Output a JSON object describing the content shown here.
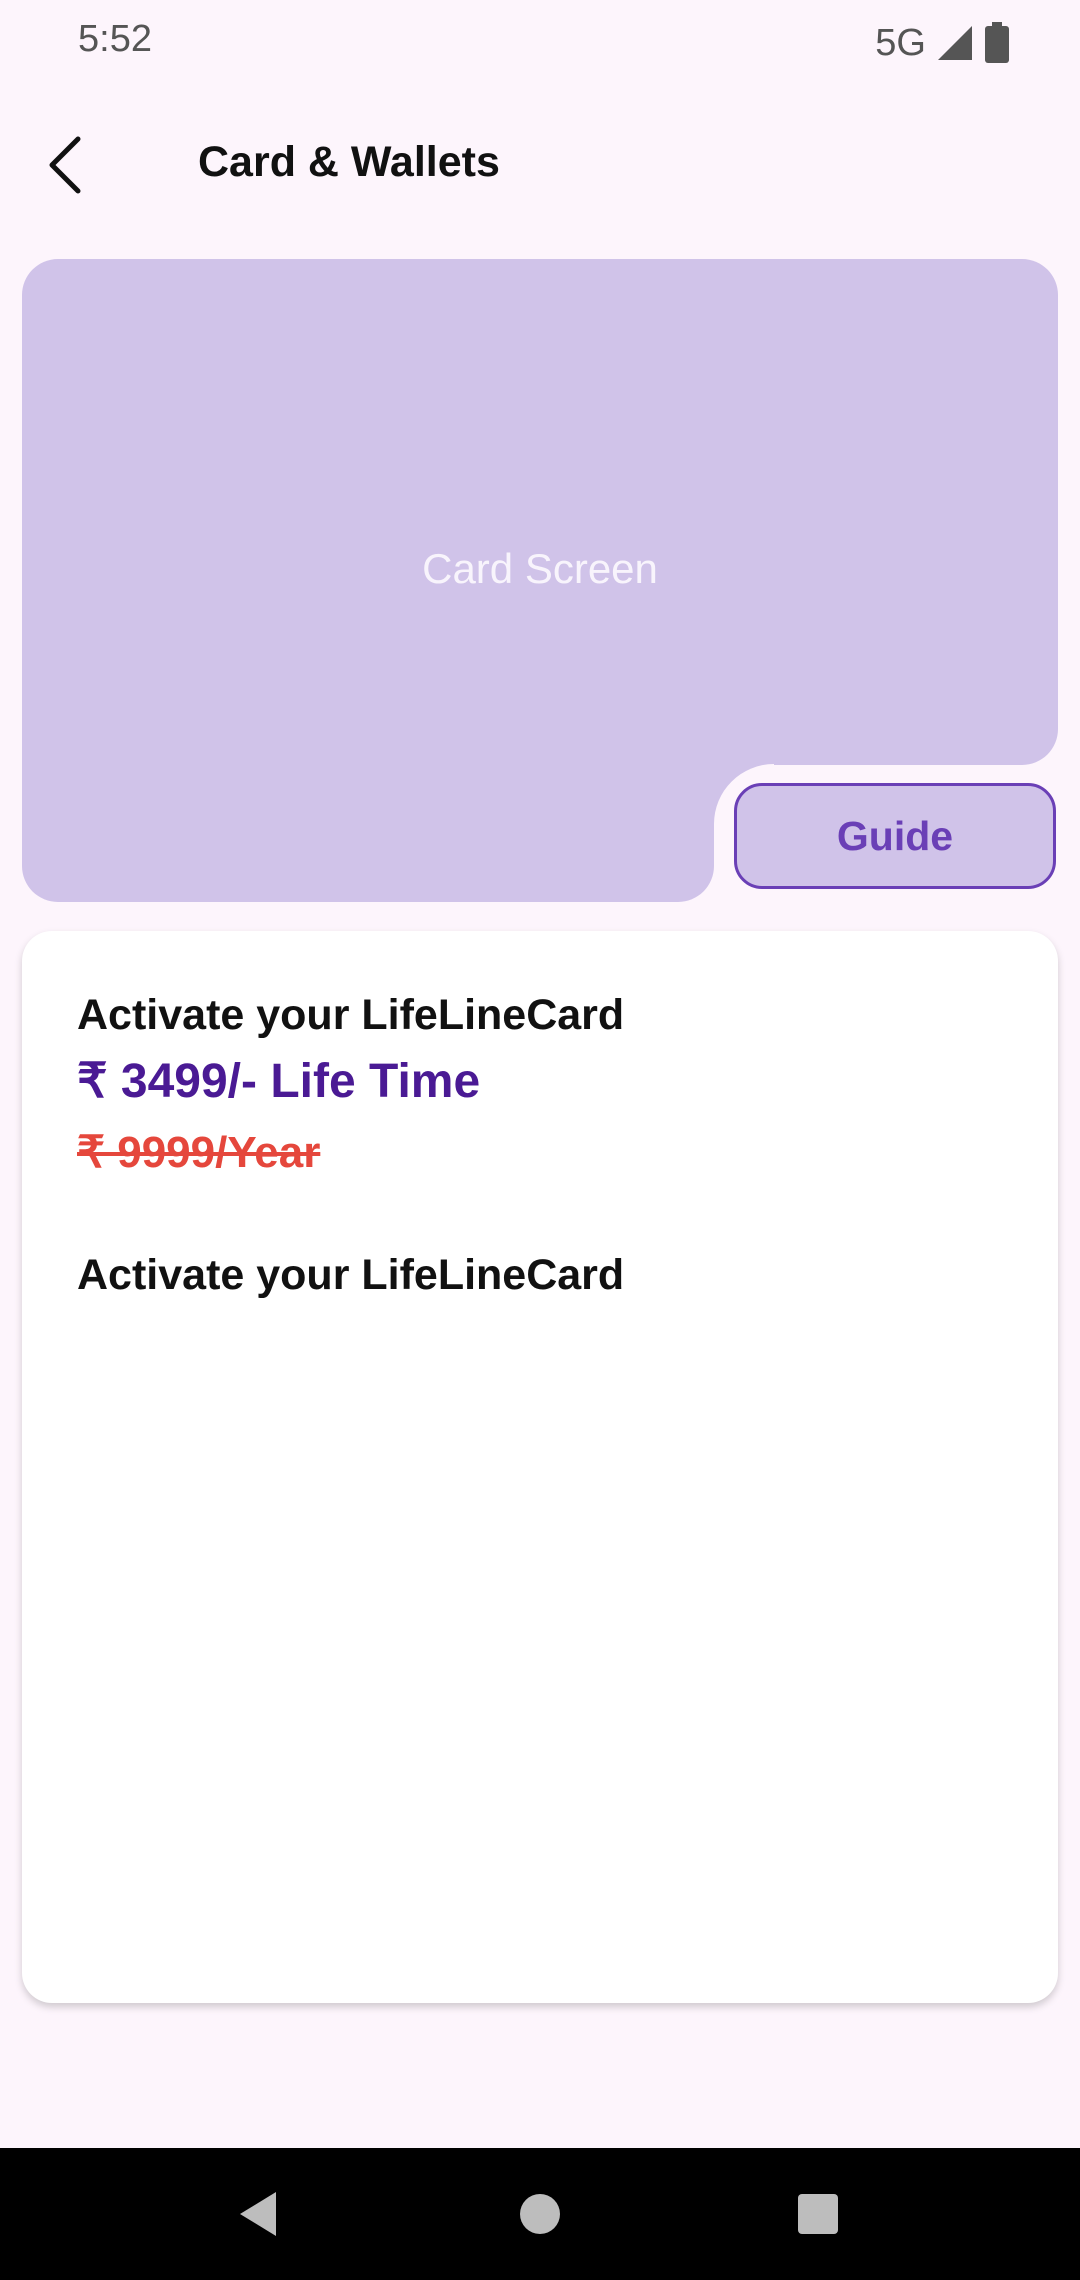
{
  "status_bar": {
    "time": "5:52",
    "network": "5G",
    "icons": [
      "signal-icon",
      "battery-icon"
    ]
  },
  "app_bar": {
    "title": "Card & Wallets",
    "back_icon": "back-arrow-icon"
  },
  "card": {
    "placeholder_label": "Card Screen",
    "background_color": "#D0C3E9",
    "guide_button_label": "Guide",
    "guide_color": "#6A3FB6"
  },
  "info": {
    "heading_1": "Activate your LifeLineCard",
    "price_main": "₹ 3499/- Life Time",
    "price_old": "₹ 9999/Year",
    "heading_2": "Activate your LifeLineCard",
    "price_main_color": "#4A1A94",
    "price_old_color": "#E5473C"
  },
  "nav_bar": {
    "icons": [
      "nav-back-icon",
      "nav-home-icon",
      "nav-recents-icon"
    ]
  }
}
